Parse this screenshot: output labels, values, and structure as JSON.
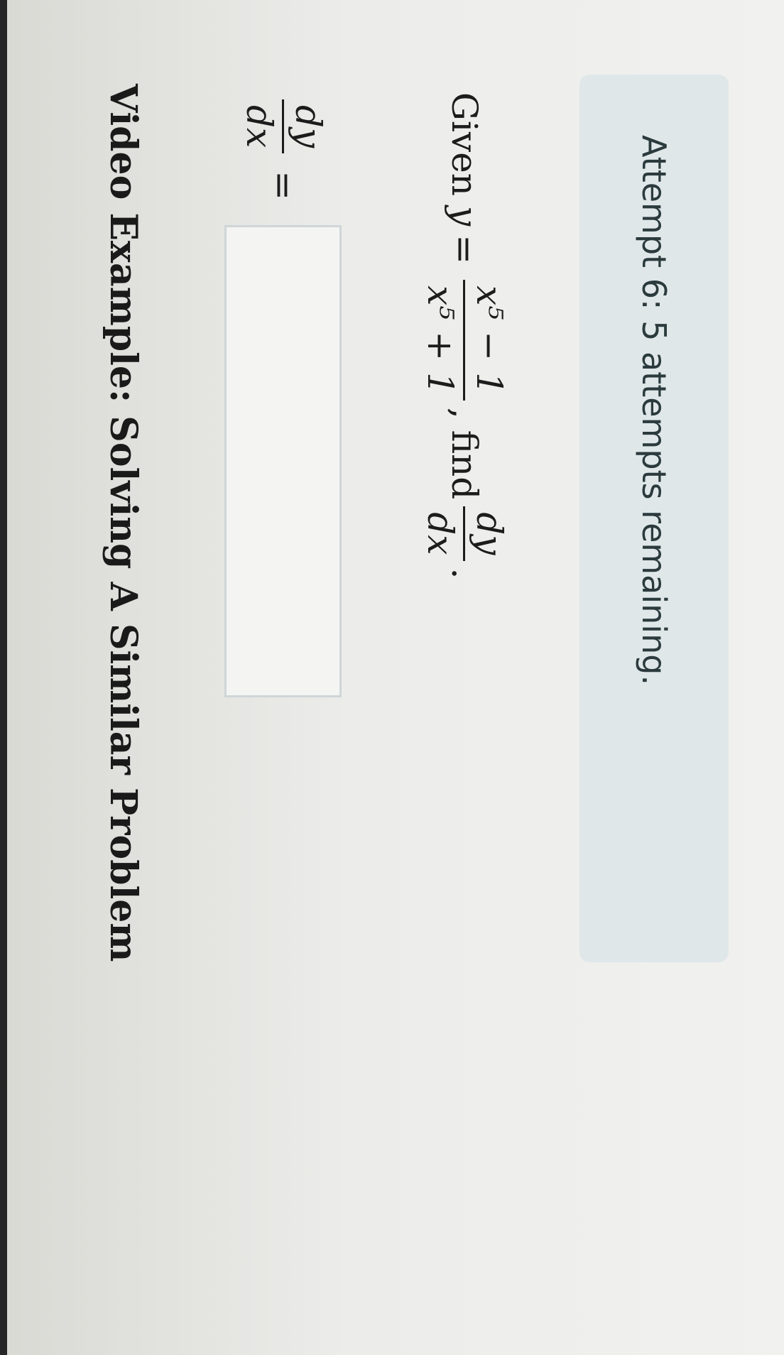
{
  "attempt_banner": {
    "text": "Attempt 6: 5 attempts remaining."
  },
  "question": {
    "given_word": "Given",
    "y_var": "y",
    "equals": "=",
    "numerator": "x⁵ − 1",
    "denominator": "x⁵ + 1",
    "find_text": ", find",
    "target_num": "dy",
    "target_den": "dx",
    "period": "."
  },
  "answer": {
    "lhs_num": "dy",
    "lhs_den": "dx",
    "equals": "=",
    "input_value": "",
    "icon": "pencil-icon"
  },
  "video": {
    "label": "Video Example: Solving A Similar Problem"
  }
}
